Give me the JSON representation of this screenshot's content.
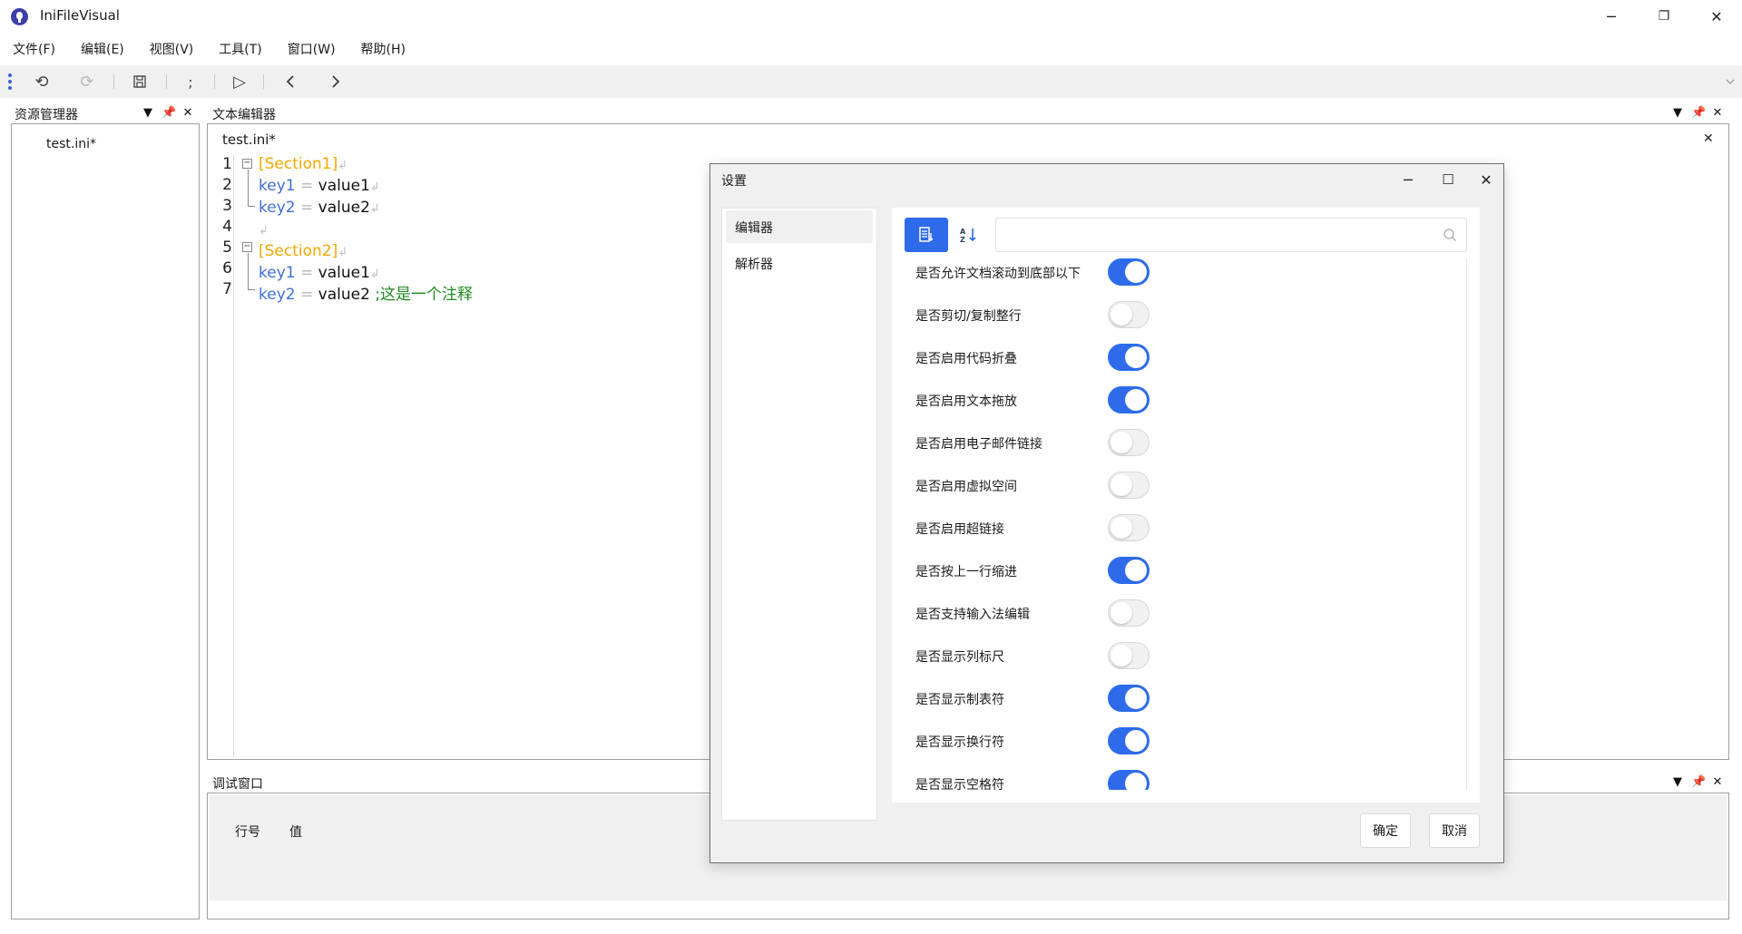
{
  "app": {
    "title": "IniFileVisual"
  },
  "window_controls": {
    "minimize": "─",
    "restore": "❐",
    "close": "✕"
  },
  "menu": [
    {
      "label": "文件(F)"
    },
    {
      "label": "编辑(E)"
    },
    {
      "label": "视图(V)"
    },
    {
      "label": "工具(T)"
    },
    {
      "label": "窗口(W)"
    },
    {
      "label": "帮助(H)"
    }
  ],
  "toolbar": {
    "items": [
      {
        "icon": "undo-icon",
        "glyph": "⟲",
        "enabled": true
      },
      {
        "icon": "redo-icon",
        "glyph": "⟳",
        "enabled": false
      },
      {
        "icon": "save-icon",
        "glyph": "🖫",
        "enabled": true
      },
      {
        "icon": "comment-icon",
        "glyph": ";",
        "enabled": true
      },
      {
        "icon": "run-icon",
        "glyph": "▷",
        "enabled": true
      },
      {
        "icon": "back-icon",
        "glyph": "〈",
        "enabled": true
      },
      {
        "icon": "forward-icon",
        "glyph": "〉",
        "enabled": true
      }
    ]
  },
  "explorer": {
    "title": "资源管理器",
    "files": [
      "test.ini*"
    ]
  },
  "editor": {
    "title": "文本编辑器",
    "tab": "test.ini*",
    "line_numbers": [
      "1",
      "2",
      "3",
      "4",
      "5",
      "6",
      "7"
    ],
    "lines": [
      {
        "section": "[Section1]"
      },
      {
        "key": "key1",
        "eq": "=",
        "value": "value1"
      },
      {
        "key": "key2",
        "eq": "=",
        "value": "value2"
      },
      {
        "empty": true
      },
      {
        "section": "[Section2]"
      },
      {
        "key": "key1",
        "eq": "=",
        "value": "value1"
      },
      {
        "key": "key2",
        "eq": "=",
        "value": "value2",
        "comment": ";这是一个注释"
      }
    ],
    "eol_glyph": "↲"
  },
  "debug": {
    "title": "调试窗口",
    "columns": [
      "行号",
      "值"
    ]
  },
  "dialog": {
    "title": "设置",
    "nav": [
      {
        "label": "编辑器",
        "active": true
      },
      {
        "label": "解析器",
        "active": false
      }
    ],
    "search_placeholder": "",
    "settings": [
      {
        "label": "是否允许文档滚动到底部以下",
        "on": true
      },
      {
        "label": "是否剪切/复制整行",
        "on": false
      },
      {
        "label": "是否启用代码折叠",
        "on": true
      },
      {
        "label": "是否启用文本拖放",
        "on": true
      },
      {
        "label": "是否启用电子邮件链接",
        "on": false
      },
      {
        "label": "是否启用虚拟空间",
        "on": false
      },
      {
        "label": "是否启用超链接",
        "on": false
      },
      {
        "label": "是否按上一行缩进",
        "on": true
      },
      {
        "label": "是否支持输入法编辑",
        "on": false
      },
      {
        "label": "是否显示列标尺",
        "on": false
      },
      {
        "label": "是否显示制表符",
        "on": true
      },
      {
        "label": "是否显示换行符",
        "on": true
      },
      {
        "label": "是否显示空格符",
        "on": true
      }
    ],
    "ok_label": "确定",
    "cancel_label": "取消",
    "accent_color": "#2d6bea"
  }
}
